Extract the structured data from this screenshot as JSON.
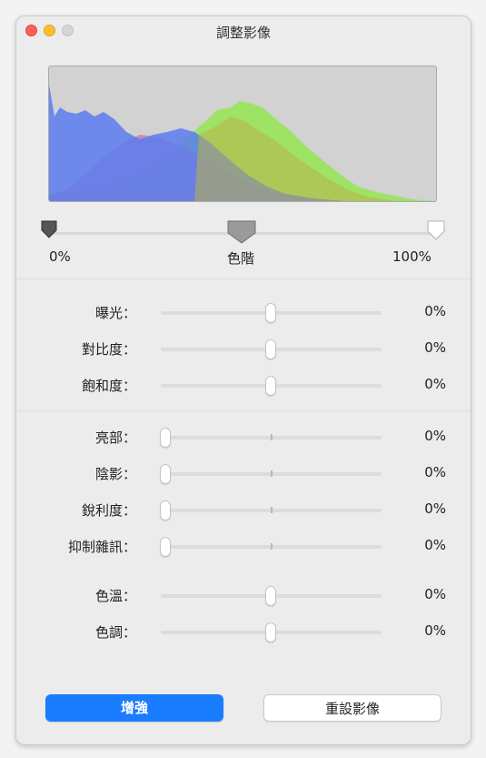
{
  "window": {
    "title": "調整影像"
  },
  "levels": {
    "black_label": "0%",
    "mid_label": "色階",
    "white_label": "100%"
  },
  "adjustments": {
    "group1": [
      {
        "label": "曝光：",
        "value": "0%"
      },
      {
        "label": "對比度：",
        "value": "0%"
      },
      {
        "label": "飽和度：",
        "value": "0%"
      }
    ],
    "group2": [
      {
        "label": "亮部：",
        "value": "0%"
      },
      {
        "label": "陰影：",
        "value": "0%"
      },
      {
        "label": "銳利度：",
        "value": "0%"
      },
      {
        "label": "抑制雜訊：",
        "value": "0%"
      }
    ],
    "group3": [
      {
        "label": "色溫：",
        "value": "0%"
      },
      {
        "label": "色調：",
        "value": "0%"
      }
    ]
  },
  "buttons": {
    "enhance": "增強",
    "reset": "重設影像"
  },
  "colors": {
    "accent": "#1a7cff",
    "close": "#fe5f57",
    "minimize": "#febc2e",
    "histogram_blue": "#5a7cf0",
    "histogram_green": "#98e45a",
    "histogram_red": "#c96ab0"
  }
}
